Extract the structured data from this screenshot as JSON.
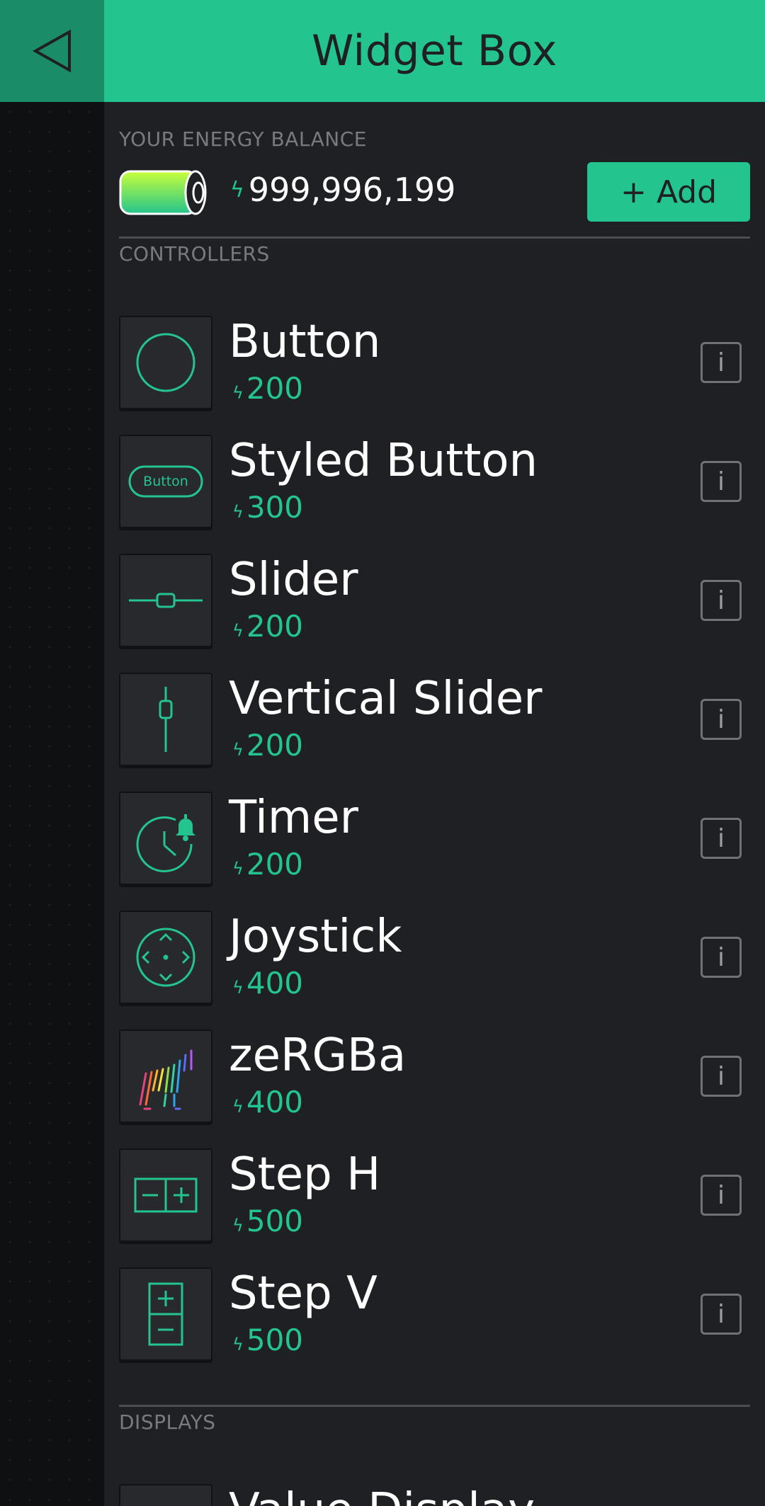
{
  "header": {
    "title": "Widget Box"
  },
  "energy": {
    "label": "YOUR ENERGY BALANCE",
    "value": "999,996,199",
    "add_label": "+ Add"
  },
  "sections": {
    "controllers": "CONTROLLERS",
    "displays": "DISPLAYS"
  },
  "widgets": [
    {
      "name": "Button",
      "price": "200",
      "icon": "button-icon"
    },
    {
      "name": "Styled Button",
      "price": "300",
      "icon": "styled-button-icon",
      "icon_text": "Button"
    },
    {
      "name": "Slider",
      "price": "200",
      "icon": "slider-icon"
    },
    {
      "name": "Vertical Slider",
      "price": "200",
      "icon": "vertical-slider-icon"
    },
    {
      "name": "Timer",
      "price": "200",
      "icon": "timer-icon"
    },
    {
      "name": "Joystick",
      "price": "400",
      "icon": "joystick-icon"
    },
    {
      "name": "zeRGBa",
      "price": "400",
      "icon": "zergba-icon"
    },
    {
      "name": "Step H",
      "price": "500",
      "icon": "step-h-icon"
    },
    {
      "name": "Step V",
      "price": "500",
      "icon": "step-v-icon"
    }
  ],
  "displays_first": {
    "name": "Value Display"
  },
  "colors": {
    "accent": "#23c48e",
    "background": "#1f2024",
    "header_text": "#1f2024"
  }
}
